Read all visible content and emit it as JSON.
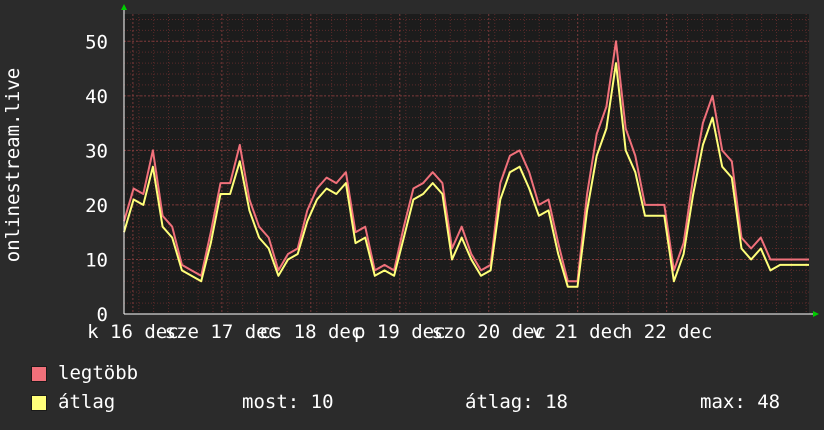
{
  "chart_data": {
    "type": "line",
    "ylabel": "onlinestream.live",
    "ylim": [
      0,
      55
    ],
    "yticks": [
      0,
      10,
      20,
      30,
      40,
      50
    ],
    "grid": true,
    "xlim": [
      0,
      7.7
    ],
    "xticks": [
      {
        "x": 0.1,
        "label": "k 16 dec"
      },
      {
        "x": 1.1,
        "label": "sze 17 dec"
      },
      {
        "x": 2.1,
        "label": "cs 18 dec"
      },
      {
        "x": 3.1,
        "label": "p 19 dec"
      },
      {
        "x": 4.1,
        "label": "szo 20 dec"
      },
      {
        "x": 5.1,
        "label": "v 21 dec"
      },
      {
        "x": 6.1,
        "label": "h 22 dec"
      }
    ],
    "x": [
      0.0,
      0.1,
      0.2,
      0.3,
      0.4,
      0.5,
      0.6,
      0.7,
      0.8,
      0.9,
      1.0,
      1.1,
      1.2,
      1.3,
      1.4,
      1.5,
      1.6,
      1.7,
      1.8,
      1.9,
      2.0,
      2.1,
      2.2,
      2.3,
      2.4,
      2.5,
      2.6,
      2.7,
      2.8,
      2.9,
      3.0,
      3.1,
      3.2,
      3.3,
      3.4,
      3.5,
      3.6,
      3.7,
      3.8,
      3.9,
      4.0,
      4.1,
      4.2,
      4.3,
      4.4,
      4.5,
      4.6,
      4.7,
      4.8,
      4.9,
      5.0,
      5.1,
      5.2,
      5.3,
      5.4,
      5.5,
      5.6,
      5.7,
      5.8,
      5.9,
      6.0,
      6.1,
      6.2,
      6.3,
      6.4,
      6.5,
      6.6,
      6.7,
      6.8,
      6.9,
      7.0,
      7.1,
      7.2,
      7.3,
      7.4,
      7.5,
      7.6,
      7.7
    ],
    "series": [
      {
        "name": "legtöbb",
        "color": "#f0707a",
        "values": [
          17,
          23,
          22,
          30,
          18,
          16,
          9,
          8,
          7,
          15,
          24,
          24,
          31,
          21,
          16,
          14,
          8,
          11,
          12,
          19,
          23,
          25,
          24,
          26,
          15,
          16,
          8,
          9,
          8,
          16,
          23,
          24,
          26,
          24,
          12,
          16,
          11,
          8,
          9,
          24,
          29,
          30,
          26,
          20,
          21,
          13,
          6,
          6,
          22,
          33,
          38,
          50,
          34,
          29,
          20,
          20,
          20,
          8,
          13,
          25,
          35,
          40,
          30,
          28,
          14,
          12,
          14,
          10,
          10,
          10,
          10,
          10
        ]
      },
      {
        "name": "átlag",
        "color": "#ffff7a",
        "values": [
          15,
          21,
          20,
          27,
          16,
          14,
          8,
          7,
          6,
          13,
          22,
          22,
          28,
          19,
          14,
          12,
          7,
          10,
          11,
          17,
          21,
          23,
          22,
          24,
          13,
          14,
          7,
          8,
          7,
          14,
          21,
          22,
          24,
          22,
          10,
          14,
          10,
          7,
          8,
          21,
          26,
          27,
          23,
          18,
          19,
          11,
          5,
          5,
          19,
          29,
          34,
          46,
          30,
          26,
          18,
          18,
          18,
          6,
          11,
          22,
          31,
          36,
          27,
          25,
          12,
          10,
          12,
          8,
          9,
          9,
          9,
          9
        ]
      }
    ]
  },
  "legend": {
    "max_label": "legtöbb",
    "avg_label": "átlag",
    "now_text": "most: 10",
    "avg_text": "átlag: 18",
    "maxv_text": "max: 48",
    "max_color": "#f0707a",
    "avg_color": "#ffff7a"
  },
  "colors": {
    "background": "#2b2b2b",
    "plot_background": "#1c1c1c",
    "grid_minor": "#5a2a2a",
    "grid_major": "#7a3a3a",
    "axis_arrow": "#00cc00"
  }
}
